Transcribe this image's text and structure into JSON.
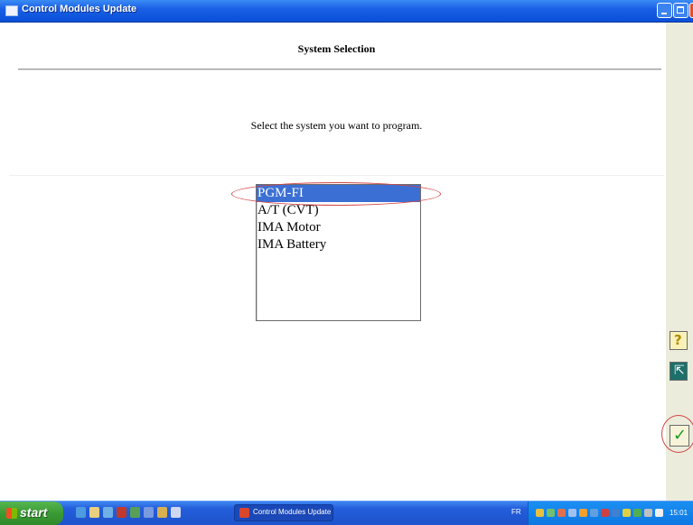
{
  "window": {
    "title": "Control Modules Update"
  },
  "main": {
    "page_title": "System Selection",
    "instruction": "Select the system you want to program."
  },
  "system_list": {
    "items": [
      "PGM-FI",
      "A/T (CVT)",
      "IMA Motor",
      "IMA Battery"
    ],
    "selected": "PGM-FI"
  },
  "side_buttons": {
    "help_icon": "question-mark-help",
    "exit_icon": "exit-door",
    "ok_icon": "green-checkmark"
  },
  "taskbar": {
    "start_label": "start",
    "task_label": "Control Modules Update",
    "language": "FR",
    "clock": "15:01"
  },
  "colors": {
    "titlebar": "#0a4fd8",
    "selection": "#3b6fd4",
    "annotation": "#d34545",
    "ok_green": "#1a9c22"
  }
}
